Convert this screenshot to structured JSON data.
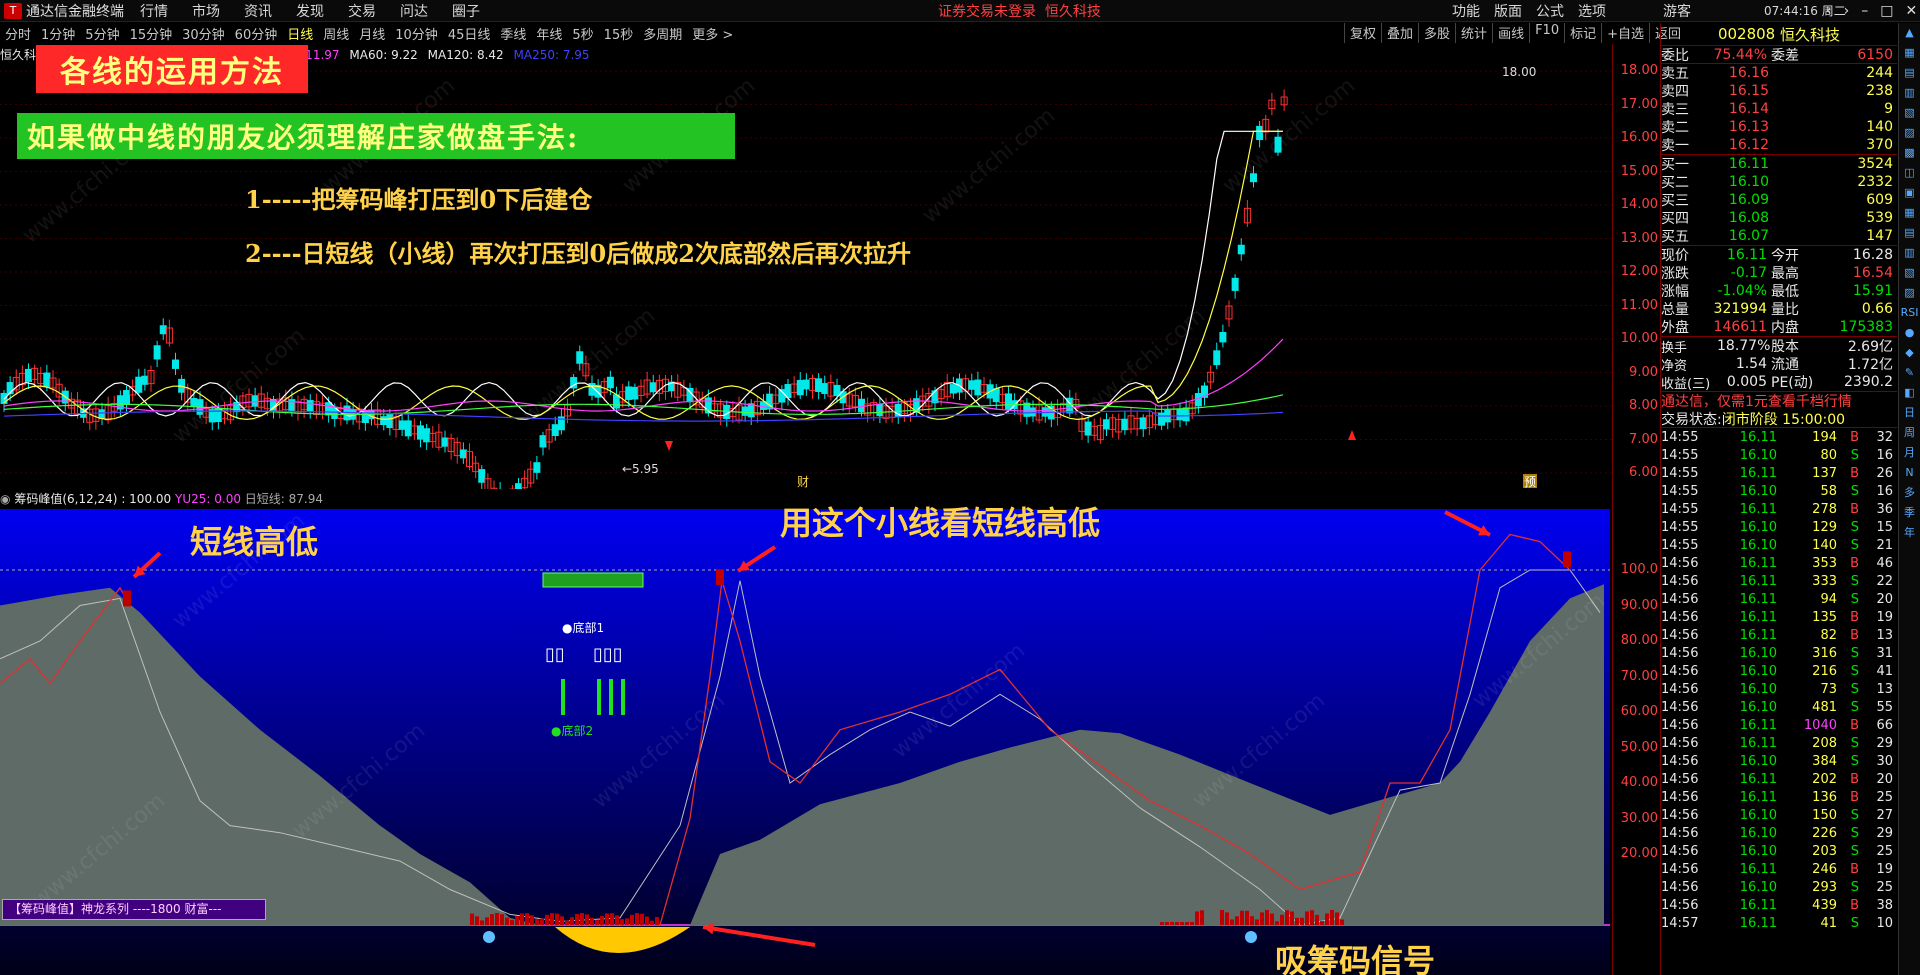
{
  "titlebar": {
    "app_name": "通达信金融终端",
    "menu": [
      "行情",
      "市场",
      "资讯",
      "发现",
      "交易",
      "问达",
      "圈子"
    ],
    "center_notice": "证券交易未登录",
    "center_stock": "恒久科技",
    "right_menu": [
      "功能",
      "版面",
      "公式",
      "选项"
    ],
    "guest": "游客",
    "clock": "07:44:16 周二"
  },
  "periods": [
    "分时",
    "1分钟",
    "5分钟",
    "15分钟",
    "30分钟",
    "60分钟",
    "日线",
    "周线",
    "月线",
    "10分钟",
    "45日线",
    "季线",
    "年线",
    "5秒",
    "15秒",
    "多周期",
    "更多 >"
  ],
  "active_period": "日线",
  "toolbar": [
    "复权",
    "叠加",
    "多股",
    "统计",
    "画线",
    "F10",
    "标记",
    "+自选",
    "返回"
  ],
  "ma_legend": {
    "stock": "恒久科",
    "ma20": "A20: 11.97",
    "ma60": "MA60: 9.22",
    "ma120": "MA120: 8.42",
    "ma250": "MA250: 7.95"
  },
  "main_yaxis": [
    "18.00",
    "17.00",
    "16.00",
    "15.00",
    "14.00",
    "13.00",
    "12.00",
    "11.00",
    "10.00",
    "9.00",
    "8.00",
    "7.00",
    "6.00"
  ],
  "main_chart_labels": {
    "high": "18.00",
    "low": "←5.95",
    "cai": "财",
    "yu": "预"
  },
  "overlay": {
    "title_red": "各线的运用方法",
    "title_green": "如果做中线的朋友必须理解庄家做盘手法:",
    "step1": "1-----把筹码峰打压到0下后建仓",
    "step2": "2----日短线（小线）再次打压到0后做成2次底部然后再次拉升"
  },
  "indicator": {
    "name": "筹码峰值(6,12,24)",
    "val1": ": 100.00",
    "yu25": "YU25: 0.00",
    "dayline": "日短线: 87.94",
    "yaxis": [
      "100.0",
      "90.00",
      "80.00",
      "70.00",
      "60.00",
      "50.00",
      "40.00",
      "30.00",
      "20.00"
    ],
    "label_short": "短线高低",
    "label_small": "用这个小线看短线高低",
    "label_absorb": "吸筹码信号",
    "legend": "【筹码峰值】神龙系列 ----1800 财富---",
    "bottom1": "●底部1",
    "bottom2": "●底部2",
    "boxes_a": "▯▯",
    "boxes_b": "▯▯▯"
  },
  "quote": {
    "code": "002808",
    "name": "恒久科技",
    "weibi_label": "委比",
    "weibi": "75.44%",
    "weicha_label": "委差",
    "weicha": "6150",
    "sell": [
      {
        "label": "卖五",
        "price": "16.16",
        "vol": "244"
      },
      {
        "label": "卖四",
        "price": "16.15",
        "vol": "238"
      },
      {
        "label": "卖三",
        "price": "16.14",
        "vol": "9"
      },
      {
        "label": "卖二",
        "price": "16.13",
        "vol": "140"
      },
      {
        "label": "卖一",
        "price": "16.12",
        "vol": "370"
      }
    ],
    "buy": [
      {
        "label": "买一",
        "price": "16.11",
        "vol": "3524"
      },
      {
        "label": "买二",
        "price": "16.10",
        "vol": "2332"
      },
      {
        "label": "买三",
        "price": "16.09",
        "vol": "609"
      },
      {
        "label": "买四",
        "price": "16.08",
        "vol": "539"
      },
      {
        "label": "买五",
        "price": "16.07",
        "vol": "147"
      }
    ],
    "stats": [
      {
        "l1": "现价",
        "v1": "16.11",
        "c1": "c-g",
        "l2": "今开",
        "v2": "16.28",
        "c2": "c-w"
      },
      {
        "l1": "涨跌",
        "v1": "-0.17",
        "c1": "c-g",
        "l2": "最高",
        "v2": "16.54",
        "c2": "c-r"
      },
      {
        "l1": "涨幅",
        "v1": "-1.04%",
        "c1": "c-g",
        "l2": "最低",
        "v2": "15.91",
        "c2": "c-g"
      },
      {
        "l1": "总量",
        "v1": "321994",
        "c1": "c-y",
        "l2": "量比",
        "v2": "0.66",
        "c2": "c-y"
      },
      {
        "l1": "外盘",
        "v1": "146611",
        "c1": "c-r",
        "l2": "内盘",
        "v2": "175383",
        "c2": "c-g"
      }
    ],
    "stats2": [
      {
        "l1": "换手",
        "v1": "18.77%",
        "l2": "股本",
        "v2": "2.69亿"
      },
      {
        "l1": "净资",
        "v1": "1.54",
        "l2": "流通",
        "v2": "1.72亿"
      },
      {
        "l1": "收益(三)",
        "v1": "0.005",
        "l2": "PE(动)",
        "v2": "2390.2"
      }
    ],
    "promo": "通达信，仅需1元查看千档行情",
    "status_label": "交易状态:",
    "status": "闭市阶段 15:00:00"
  },
  "ticks": [
    [
      "14:55",
      "16.11",
      "194",
      "B",
      "32"
    ],
    [
      "14:55",
      "16.10",
      "80",
      "S",
      "16"
    ],
    [
      "14:55",
      "16.11",
      "137",
      "B",
      "26"
    ],
    [
      "14:55",
      "16.10",
      "58",
      "S",
      "16"
    ],
    [
      "14:55",
      "16.11",
      "278",
      "B",
      "36"
    ],
    [
      "14:55",
      "16.10",
      "129",
      "S",
      "15"
    ],
    [
      "14:55",
      "16.10",
      "140",
      "S",
      "21"
    ],
    [
      "14:56",
      "16.11",
      "353",
      "B",
      "46"
    ],
    [
      "14:56",
      "16.11",
      "333",
      "S",
      "22"
    ],
    [
      "14:56",
      "16.11",
      "94",
      "S",
      "20"
    ],
    [
      "14:56",
      "16.11",
      "135",
      "B",
      "19"
    ],
    [
      "14:56",
      "16.11",
      "82",
      "B",
      "13"
    ],
    [
      "14:56",
      "16.10",
      "316",
      "S",
      "31"
    ],
    [
      "14:56",
      "16.10",
      "216",
      "S",
      "41"
    ],
    [
      "14:56",
      "16.10",
      "73",
      "S",
      "13"
    ],
    [
      "14:56",
      "16.10",
      "481",
      "S",
      "55"
    ],
    [
      "14:56",
      "16.11",
      "1040",
      "B",
      "66"
    ],
    [
      "14:56",
      "16.11",
      "208",
      "S",
      "29"
    ],
    [
      "14:56",
      "16.10",
      "384",
      "S",
      "30"
    ],
    [
      "14:56",
      "16.11",
      "202",
      "B",
      "20"
    ],
    [
      "14:56",
      "16.11",
      "136",
      "B",
      "25"
    ],
    [
      "14:56",
      "16.10",
      "150",
      "S",
      "27"
    ],
    [
      "14:56",
      "16.10",
      "226",
      "S",
      "29"
    ],
    [
      "14:56",
      "16.10",
      "203",
      "S",
      "25"
    ],
    [
      "14:56",
      "16.11",
      "246",
      "B",
      "19"
    ],
    [
      "14:56",
      "16.10",
      "293",
      "S",
      "25"
    ],
    [
      "14:56",
      "16.11",
      "439",
      "B",
      "38"
    ],
    [
      "14:57",
      "16.11",
      "41",
      "S",
      "10"
    ]
  ],
  "sidebar_icons": [
    "RSI",
    "日",
    "周",
    "月",
    "N",
    "多",
    "季",
    "年"
  ],
  "colors": {
    "bg": "#000000",
    "panel_blue": "#0000e0",
    "mountain": "#5f6b66",
    "red": "#ff3030",
    "yellow_label": "#ffd24a"
  }
}
